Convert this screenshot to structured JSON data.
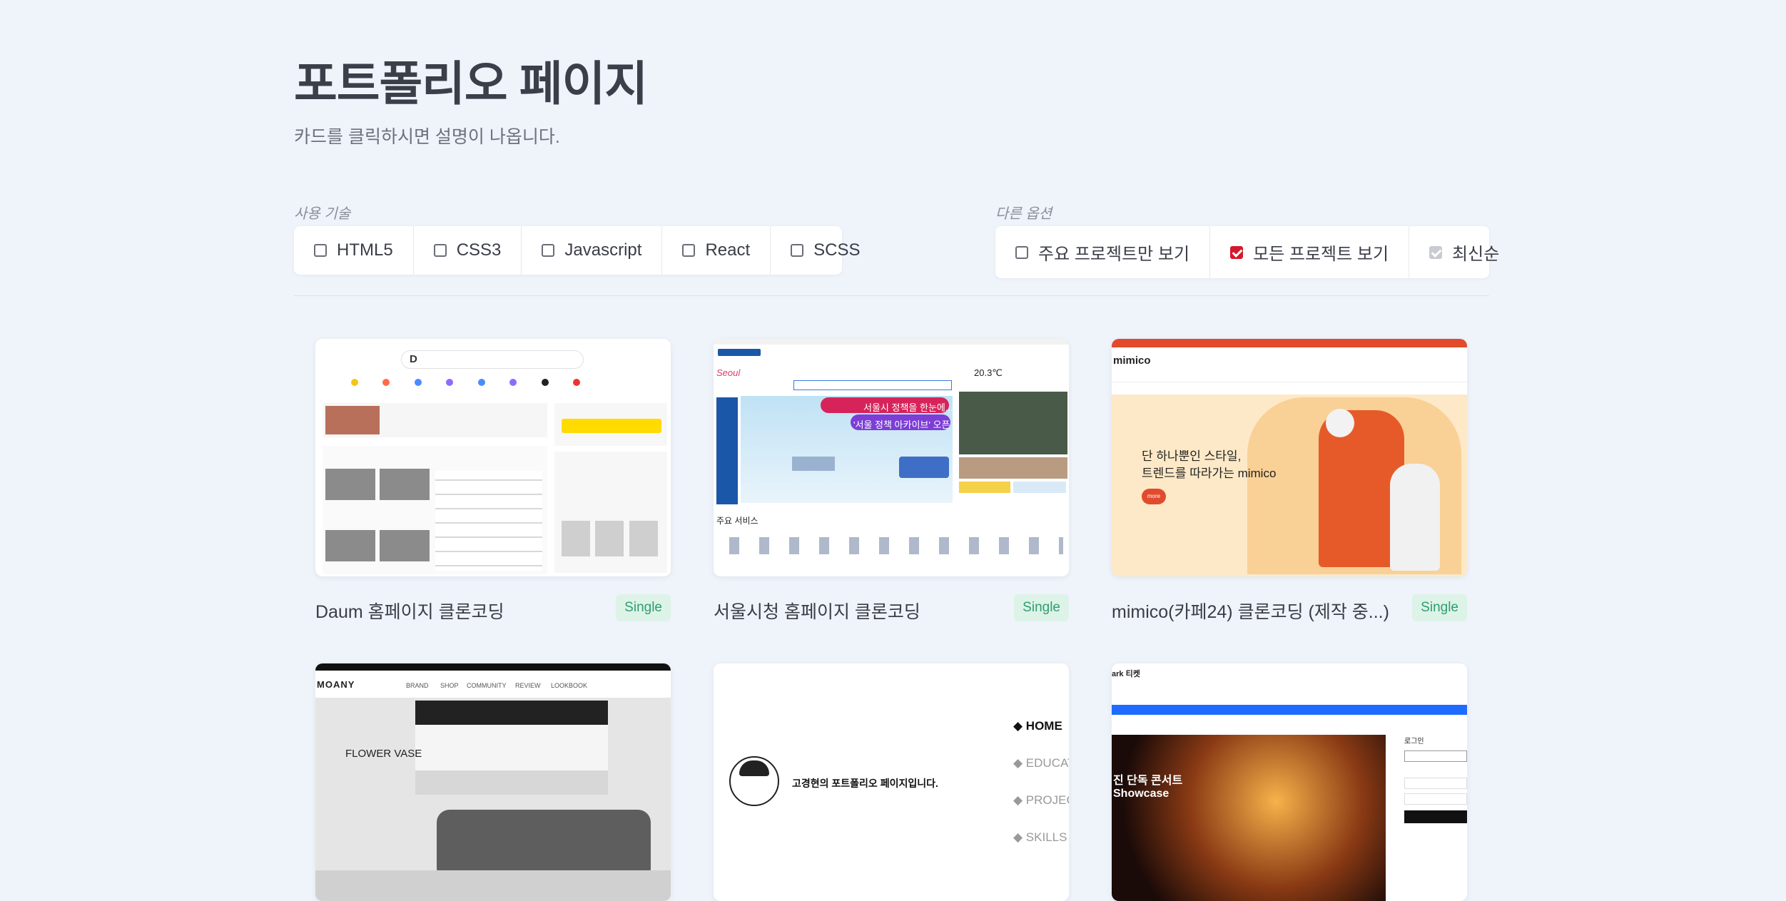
{
  "header": {
    "title": "포트폴리오 페이지",
    "subtitle": "카드를 클릭하시면 설명이 나옵니다."
  },
  "filters": {
    "tech_label": "사용 기술",
    "tech": [
      {
        "label": "HTML5",
        "checked": false
      },
      {
        "label": "CSS3",
        "checked": false
      },
      {
        "label": "Javascript",
        "checked": false
      },
      {
        "label": "React",
        "checked": false
      },
      {
        "label": "SCSS",
        "checked": false
      }
    ],
    "options_label": "다른 옵션",
    "options": [
      {
        "label": "주요 프로젝트만 보기",
        "checked": false
      },
      {
        "label": "모든 프로젝트 보기",
        "checked": true
      },
      {
        "label": "최신순",
        "checked": true,
        "disabled": true
      }
    ]
  },
  "cards": [
    {
      "title": "Daum 홈페이지 클론코딩",
      "badge": "Single"
    },
    {
      "title": "서울시청 홈페이지 클론코딩",
      "badge": "Single"
    },
    {
      "title": "mimico(카페24) 클론코딩 (제작 중...)",
      "badge": "Single"
    }
  ],
  "thumbs": {
    "seoul": {
      "banner1": "서울시 정책을 한눈에...",
      "banner2": "'서울 정책 아카이브' 오픈",
      "temp": "20.3℃",
      "section": "주요 서비스"
    },
    "mimico": {
      "logo": "mimico",
      "line1": "단 하나뿐인 스타일,",
      "line2": "트렌드를 따라가는 mimico",
      "btn": "more"
    },
    "moany": {
      "logo": "MOANY",
      "menu": [
        "BRAND",
        "SHOP",
        "COMMUNITY",
        "REVIEW",
        "LOOKBOOK"
      ],
      "headline": "FLOWER VASE"
    },
    "portfolio": {
      "intro": "고경현의 포트폴리오 페이지입니다.",
      "nav": [
        "HOME",
        "EDUCAT",
        "PROJEC",
        "SKILLS"
      ]
    },
    "ticket": {
      "logo": "ark 티켓",
      "line1": "진 단독 콘서트",
      "line2": "Showcase",
      "login": "로그인"
    }
  },
  "colors": {
    "accent": "#d5192b",
    "badge_bg": "#ddf3e8",
    "badge_text": "#2f9e6b",
    "page_bg": "#eff3fa"
  }
}
